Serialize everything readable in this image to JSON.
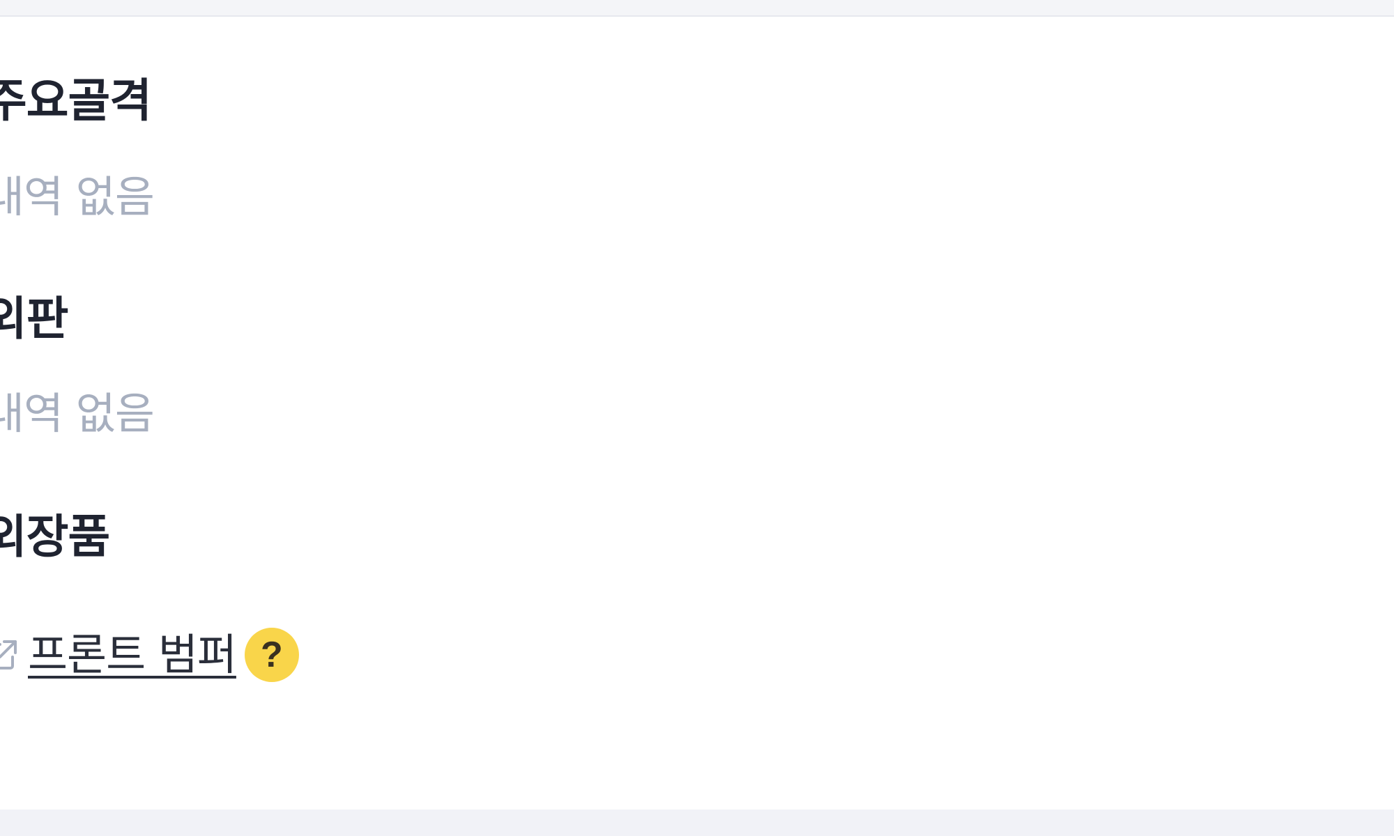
{
  "sections": [
    {
      "title": "주요골격",
      "empty_text": "내역 없음"
    },
    {
      "title": "외판",
      "empty_text": "내역 없음"
    },
    {
      "title": "외장품"
    }
  ],
  "exterior_parts": [
    {
      "label": "프론트 범퍼",
      "help_label": "?"
    }
  ],
  "colors": {
    "help_badge": "#f9d54a",
    "empty_text": "#a7afbf",
    "title_text": "#1f2330"
  },
  "icons": {
    "external_link": "external-link-icon",
    "help": "help-icon"
  }
}
